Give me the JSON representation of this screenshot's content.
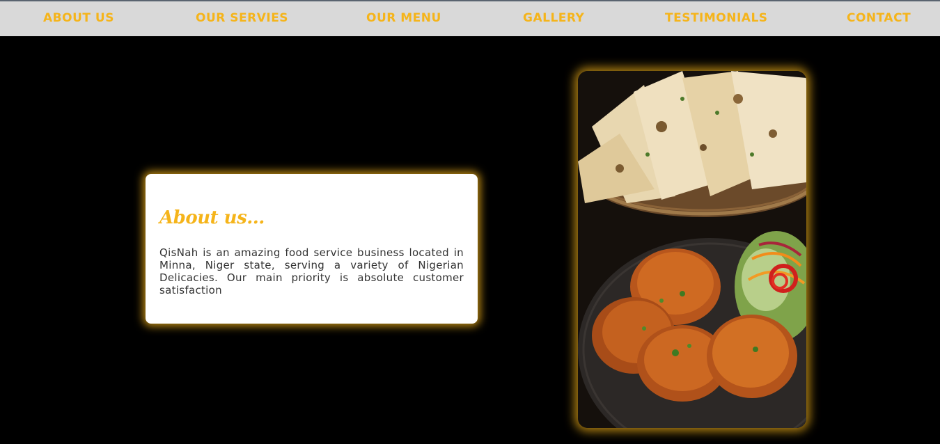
{
  "nav": {
    "items": [
      {
        "label": "ABOUT US"
      },
      {
        "label": "OUR SERVIES"
      },
      {
        "label": "OUR MENU"
      },
      {
        "label": "GALLERY"
      },
      {
        "label": "TESTIMONIALS"
      },
      {
        "label": "CONTACT"
      }
    ]
  },
  "about": {
    "title": "About us...",
    "body": "QisNah is an amazing food service business located in Minna, Niger state, serving a variety of Nigerian Delicacies. Our main priority is absolute customer satisfaction"
  },
  "colors": {
    "accent": "#f5b41a",
    "nav_bg": "#d9d9d9",
    "page_bg": "#000000",
    "card_bg": "#ffffff"
  }
}
